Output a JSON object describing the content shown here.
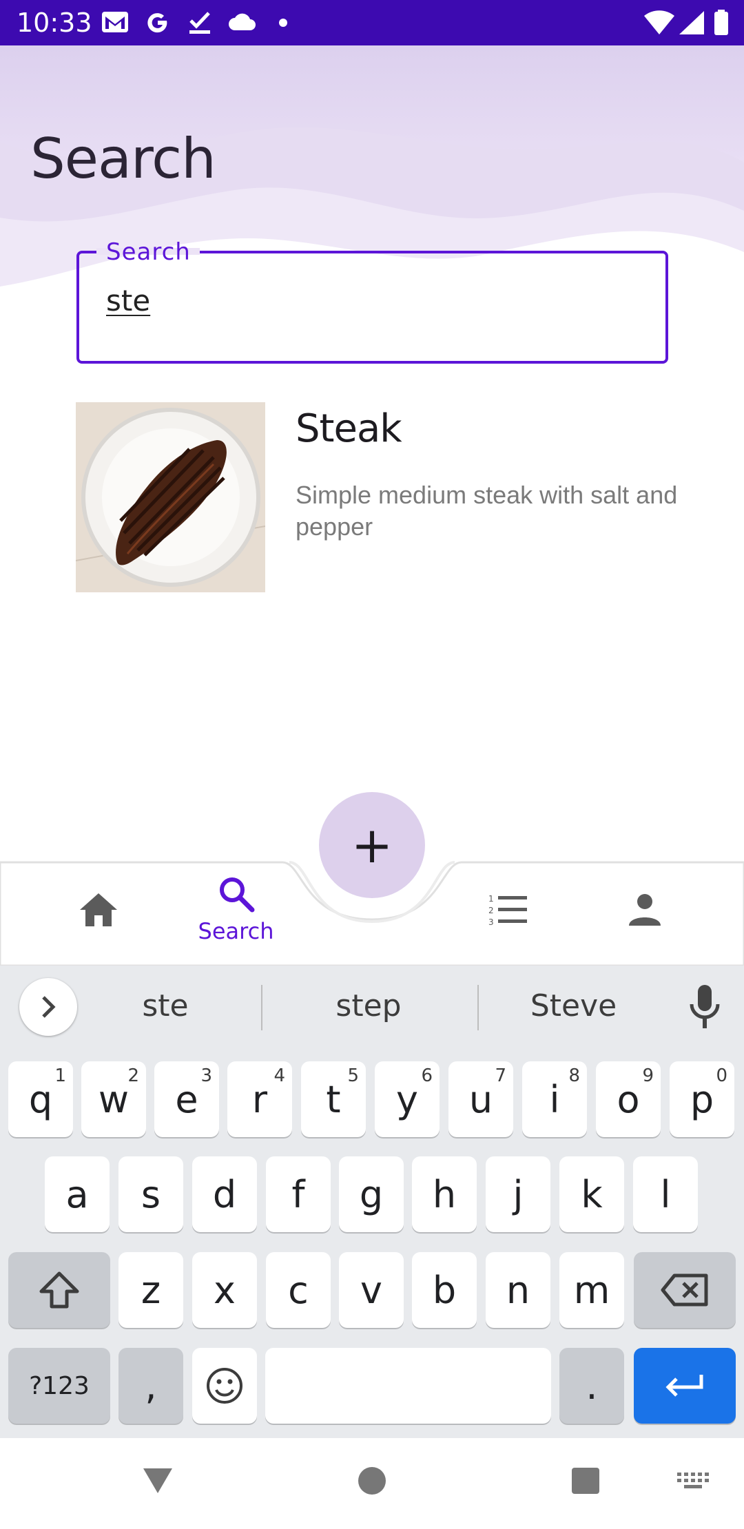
{
  "status_bar": {
    "time": "10:33",
    "left_icons": [
      "gmail-icon",
      "google-icon",
      "check-icon",
      "cloud-icon",
      "dot-icon"
    ],
    "right_icons": [
      "wifi-icon",
      "signal-icon",
      "battery-icon"
    ],
    "bg_color": "#3d0ab0"
  },
  "header": {
    "title": "Search"
  },
  "search": {
    "label": "Search",
    "value": "ste",
    "accent_color": "#5c15d8"
  },
  "results": [
    {
      "title": "Steak",
      "description": "Simple medium steak with salt and pepper",
      "image": "steak-photo"
    }
  ],
  "fab": {
    "icon": "plus-icon",
    "label": "+"
  },
  "bottom_nav": {
    "items": [
      {
        "icon": "home-icon",
        "label": ""
      },
      {
        "icon": "search-icon",
        "label": "Search",
        "active": true
      },
      {
        "icon": "list-icon",
        "label": ""
      },
      {
        "icon": "person-icon",
        "label": ""
      }
    ]
  },
  "keyboard": {
    "suggestions": [
      "ste",
      "step",
      "Steve"
    ],
    "row1": [
      {
        "k": "q",
        "n": "1"
      },
      {
        "k": "w",
        "n": "2"
      },
      {
        "k": "e",
        "n": "3"
      },
      {
        "k": "r",
        "n": "4"
      },
      {
        "k": "t",
        "n": "5"
      },
      {
        "k": "y",
        "n": "6"
      },
      {
        "k": "u",
        "n": "7"
      },
      {
        "k": "i",
        "n": "8"
      },
      {
        "k": "o",
        "n": "9"
      },
      {
        "k": "p",
        "n": "0"
      }
    ],
    "row2": [
      "a",
      "s",
      "d",
      "f",
      "g",
      "h",
      "j",
      "k",
      "l"
    ],
    "row3": [
      "z",
      "x",
      "c",
      "v",
      "b",
      "n",
      "m"
    ],
    "symbols_label": "?123",
    "comma_label": ",",
    "period_label": ".",
    "enter_color": "#1a73e8"
  }
}
